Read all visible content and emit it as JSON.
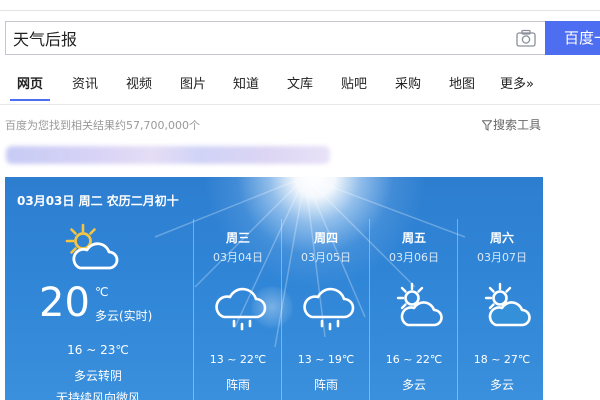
{
  "search": {
    "query": "天气后报",
    "button_label": "百度一下"
  },
  "tabs": [
    {
      "label": "网页",
      "active": true
    },
    {
      "label": "资讯"
    },
    {
      "label": "视频"
    },
    {
      "label": "图片"
    },
    {
      "label": "知道"
    },
    {
      "label": "文库"
    },
    {
      "label": "贴吧"
    },
    {
      "label": "采购"
    },
    {
      "label": "地图"
    },
    {
      "label": "更多»"
    }
  ],
  "results": {
    "count_text": "百度为您找到相关结果约57,700,000个",
    "tools_label": "搜索工具"
  },
  "weather": {
    "date_line": "03月03日 周二 农历二月初十",
    "today": {
      "icon": "partly-cloudy-icon",
      "temp": "20",
      "unit": "℃",
      "desc": "多云(实时)",
      "range": "16 ~ 23℃",
      "trend": "多云转阴",
      "wind": "无持续风向微风"
    },
    "forecast": [
      {
        "weekday": "周三",
        "date": "03月04日",
        "icon": "rain-cloud-icon",
        "range": "13 ~ 22℃",
        "condition": "阵雨"
      },
      {
        "weekday": "周四",
        "date": "03月05日",
        "icon": "rain-cloud-icon",
        "range": "13 ~ 19℃",
        "condition": "阵雨"
      },
      {
        "weekday": "周五",
        "date": "03月06日",
        "icon": "sun-cloud-icon",
        "range": "16 ~ 22℃",
        "condition": "多云"
      },
      {
        "weekday": "周六",
        "date": "03月07日",
        "icon": "sun-cloud-icon",
        "range": "18 ~ 27℃",
        "condition": "多云"
      }
    ]
  },
  "colors": {
    "accent": "#4e6ef2",
    "card_blue": "#2f84d6"
  }
}
